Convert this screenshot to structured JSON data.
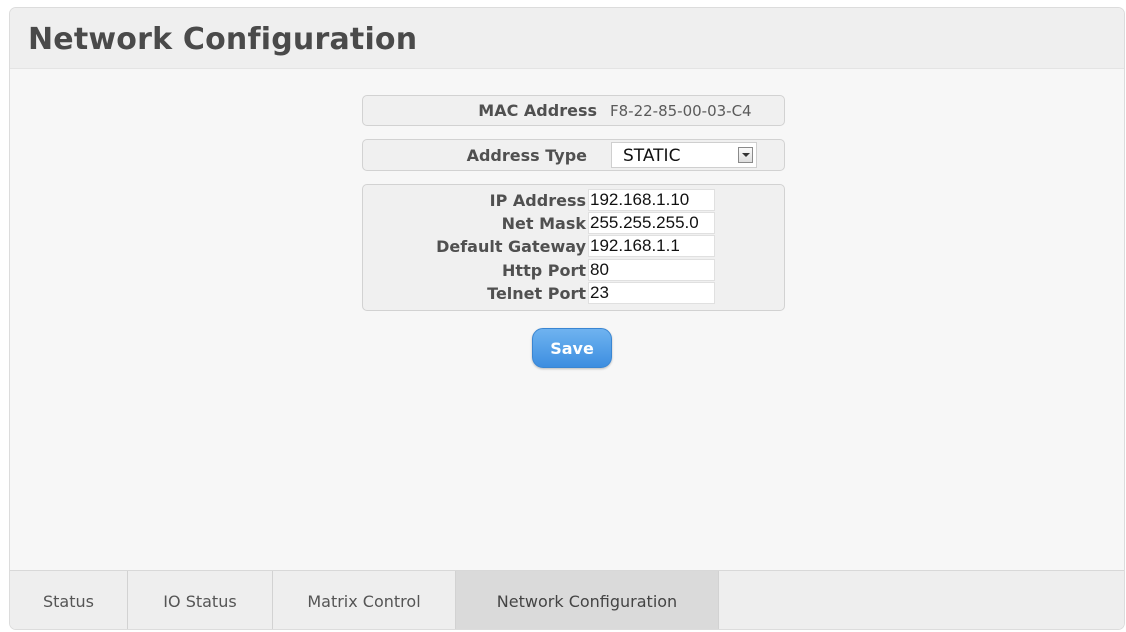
{
  "page": {
    "title": "Network Configuration"
  },
  "mac": {
    "label": "MAC Address",
    "value": "F8-22-85-00-03-C4"
  },
  "address_type": {
    "label": "Address Type",
    "selected": "STATIC"
  },
  "fields": [
    {
      "label": "IP Address",
      "value": "192.168.1.10"
    },
    {
      "label": "Net Mask",
      "value": "255.255.255.0"
    },
    {
      "label": "Default Gateway",
      "value": "192.168.1.1"
    },
    {
      "label": "Http Port",
      "value": "80"
    },
    {
      "label": "Telnet Port",
      "value": "23"
    }
  ],
  "actions": {
    "save_label": "Save"
  },
  "tabs": [
    {
      "label": "Status",
      "active": false
    },
    {
      "label": "IO Status",
      "active": false
    },
    {
      "label": "Matrix Control",
      "active": false
    },
    {
      "label": "Network Configuration",
      "active": true
    }
  ],
  "colors": {
    "save_button": "#4a96e4",
    "active_tab": "#dadada",
    "panel_background": "#f7f7f7"
  }
}
